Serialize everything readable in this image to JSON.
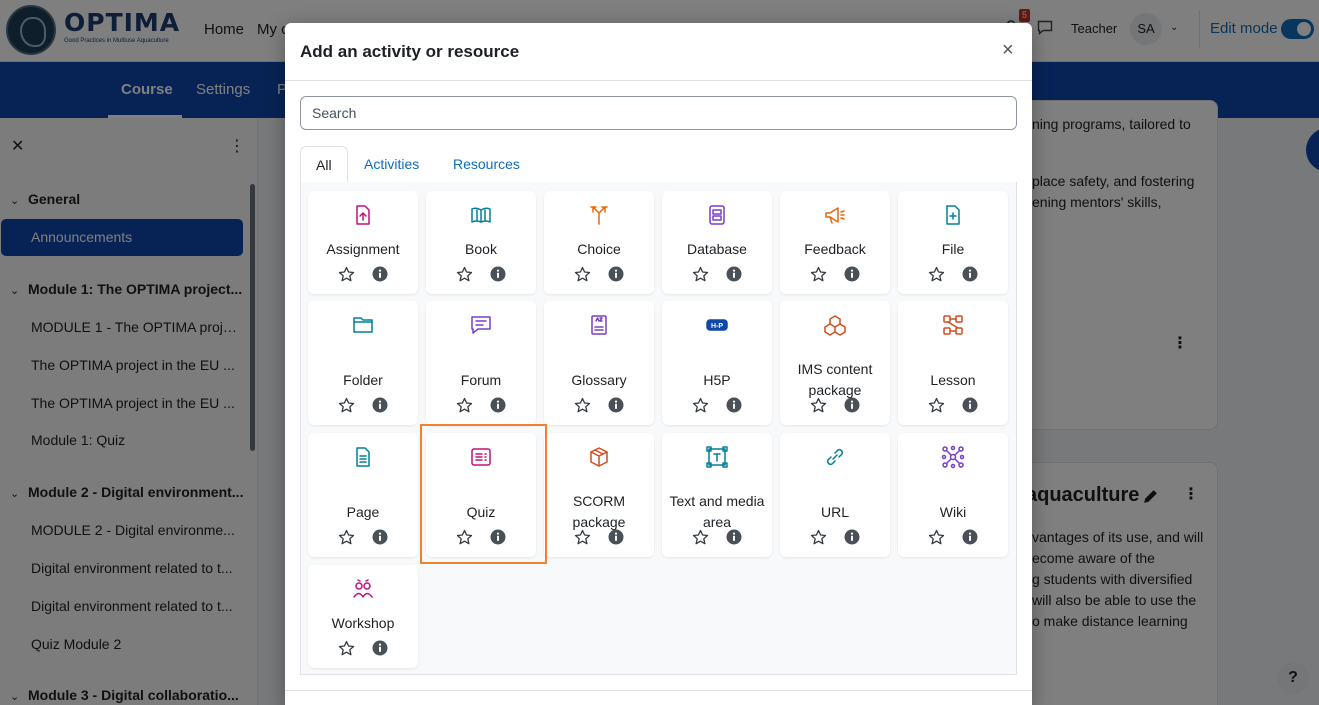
{
  "header": {
    "brand": "OPTIMA",
    "brand_sub": "Good Practices in Multiuse Aquaculture",
    "nav": [
      "Home",
      "My c"
    ],
    "notifications": "5",
    "role": "Teacher",
    "avatar_initials": "SA",
    "edit_mode_label": "Edit mode"
  },
  "course_nav": [
    "Course",
    "Settings",
    "P"
  ],
  "drawer": {
    "close": "✕",
    "more": "⋮",
    "sections": [
      {
        "title": "General",
        "items": [
          "Announcements"
        ]
      },
      {
        "title": "Module 1: The OPTIMA project...",
        "items": [
          "MODULE 1 - The OPTIMA proje...",
          "The OPTIMA project in the EU ...",
          "The OPTIMA project in the EU ...",
          "Module 1: Quiz"
        ]
      },
      {
        "title": "Module 2 - Digital environment...",
        "items": [
          "MODULE 2 - Digital environme...",
          "Digital environment related to t...",
          "Digital environment related to t...",
          "Quiz Module 2"
        ]
      },
      {
        "title": "Module 3 - Digital collaboratio...",
        "items": []
      }
    ]
  },
  "background": {
    "lines_top": [
      "ning programs, tailored to",
      "place safety, and fostering",
      "ening mentors' skills,"
    ],
    "heading": "aquaculture",
    "lines_bottom": [
      "vantages of its use, and will",
      "ecome aware of the",
      "g students with diversified",
      "will also be able to use the",
      "o make distance learning"
    ],
    "help": "?"
  },
  "modal": {
    "title": "Add an activity or resource",
    "close": "×",
    "search_placeholder": "Search",
    "search_value": "",
    "tabs": [
      "All",
      "Activities",
      "Resources"
    ],
    "active_tab": "All",
    "highlighted": "Quiz",
    "tiles": [
      {
        "name": "Assignment",
        "icon": "assignment-icon",
        "color": "#c2127a"
      },
      {
        "name": "Book",
        "icon": "book-icon",
        "color": "#008196"
      },
      {
        "name": "Choice",
        "icon": "choice-icon",
        "color": "#eb6608"
      },
      {
        "name": "Database",
        "icon": "database-icon",
        "color": "#7a3ec9"
      },
      {
        "name": "Feedback",
        "icon": "feedback-icon",
        "color": "#eb6608"
      },
      {
        "name": "File",
        "icon": "file-icon",
        "color": "#008196"
      },
      {
        "name": "Folder",
        "icon": "folder-icon",
        "color": "#008196"
      },
      {
        "name": "Forum",
        "icon": "forum-icon",
        "color": "#7a3ec9"
      },
      {
        "name": "Glossary",
        "icon": "glossary-icon",
        "color": "#7a3ec9"
      },
      {
        "name": "H5P",
        "icon": "h5p-icon",
        "color": "#0f47ad"
      },
      {
        "name": "IMS content package",
        "icon": "ims-package-icon",
        "color": "#d14d1f"
      },
      {
        "name": "Lesson",
        "icon": "lesson-icon",
        "color": "#d14d1f"
      },
      {
        "name": "Page",
        "icon": "page-icon",
        "color": "#008196"
      },
      {
        "name": "Quiz",
        "icon": "quiz-icon",
        "color": "#c2127a"
      },
      {
        "name": "SCORM package",
        "icon": "scorm-icon",
        "color": "#d14d1f"
      },
      {
        "name": "Text and media area",
        "icon": "text-media-icon",
        "color": "#008196"
      },
      {
        "name": "URL",
        "icon": "link-icon",
        "color": "#008196"
      },
      {
        "name": "Wiki",
        "icon": "wiki-icon",
        "color": "#7a3ec9"
      },
      {
        "name": "Workshop",
        "icon": "workshop-icon",
        "color": "#c2127a"
      }
    ]
  }
}
